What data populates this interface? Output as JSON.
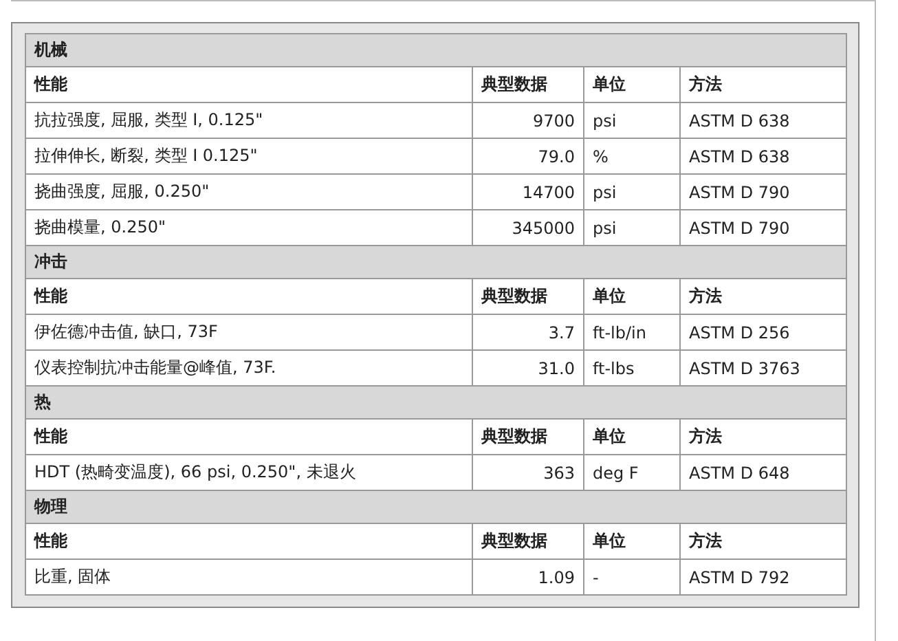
{
  "sections": [
    {
      "title": "机械",
      "columns": [
        "性能",
        "典型数据",
        "单位",
        "方法"
      ],
      "rows": [
        [
          "抗拉强度, 屈服, 类型 I, 0.125\"",
          "9700",
          "psi",
          "ASTM D 638"
        ],
        [
          "拉伸伸长, 断裂, 类型 I 0.125\"",
          "79.0",
          "%",
          "ASTM D 638"
        ],
        [
          "挠曲强度, 屈服, 0.250\"",
          "14700",
          "psi",
          "ASTM D 790"
        ],
        [
          "挠曲模量, 0.250\"",
          "345000",
          "psi",
          "ASTM D 790"
        ]
      ]
    },
    {
      "title": "冲击",
      "columns": [
        "性能",
        "典型数据",
        "单位",
        "方法"
      ],
      "rows": [
        [
          "伊佐德冲击值, 缺口, 73F",
          "3.7",
          "ft-lb/in",
          "ASTM D 256"
        ],
        [
          "仪表控制抗冲击能量@峰值, 73F.",
          "31.0",
          "ft-lbs",
          "ASTM D 3763"
        ]
      ]
    },
    {
      "title": "热",
      "columns": [
        "性能",
        "典型数据",
        "单位",
        "方法"
      ],
      "rows": [
        [
          "HDT (热畸变温度), 66 psi, 0.250\", 未退火",
          "363",
          "deg F",
          "ASTM D 648"
        ]
      ]
    },
    {
      "title": "物理",
      "columns": [
        "性能",
        "典型数据",
        "单位",
        "方法"
      ],
      "rows": [
        [
          "比重, 固体",
          "1.09",
          "-",
          "ASTM D 792"
        ]
      ]
    }
  ]
}
